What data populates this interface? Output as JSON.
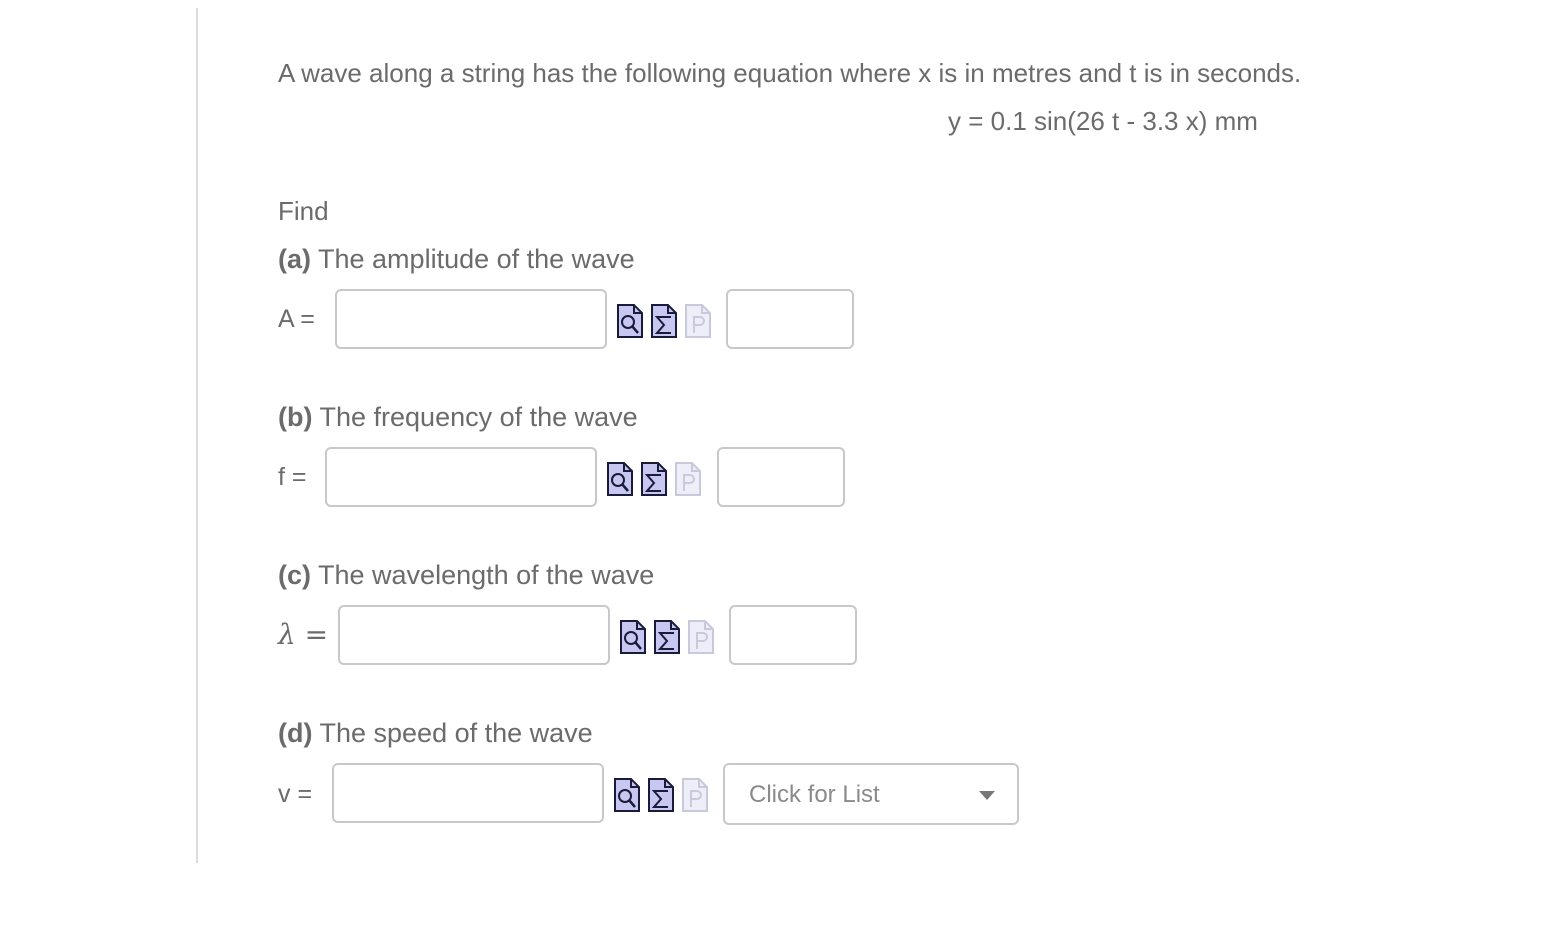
{
  "intro": "A wave along a string has the following equation where x is in metres and t is in seconds.",
  "equation": "y = 0.1 sin(26 t - 3.3 x) mm",
  "find": "Find",
  "questions": [
    {
      "letter": "(a)",
      "text": "The amplitude of the wave",
      "variable": "A =",
      "value": "",
      "unit": ""
    },
    {
      "letter": "(b)",
      "text": "The frequency of the wave",
      "variable": "f =",
      "value": "",
      "unit": ""
    },
    {
      "letter": "(c)",
      "text": "The wavelength of the wave",
      "variable": "λ =",
      "value": "",
      "unit": ""
    },
    {
      "letter": "(d)",
      "text": "The speed of the wave",
      "variable": "v =",
      "value": "",
      "unit_select": "Click for List"
    }
  ],
  "icons": {
    "preview": "preview-icon",
    "equation": "equation-editor-icon",
    "physics": "physics-constants-icon"
  },
  "colors": {
    "icon_fill": "#c7c7f2",
    "icon_stroke": "#1a1a3a",
    "icon_disabled": "#c9c9dc",
    "text": "#6b6b6b",
    "border": "#c8c8c8"
  }
}
